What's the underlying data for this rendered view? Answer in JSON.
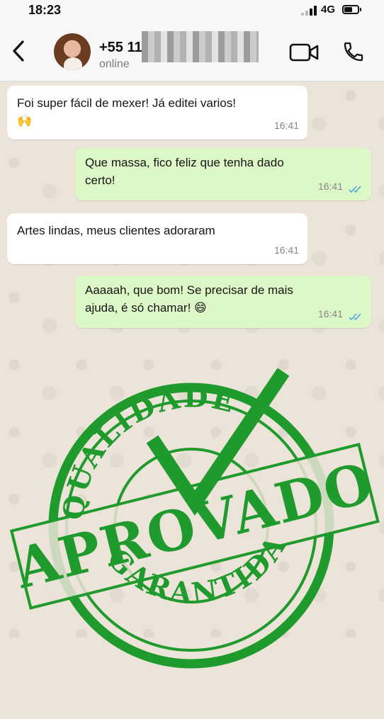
{
  "status_bar": {
    "time": "18:23",
    "network": "4G"
  },
  "header": {
    "contact_name": "+55 11",
    "contact_status": "online",
    "icons": [
      "back-arrow-icon",
      "video-call-icon",
      "phone-icon"
    ]
  },
  "messages": [
    {
      "direction": "in",
      "text": "Foi super fácil de mexer! Já editei varios!",
      "emoji": "🙌",
      "time": "16:41"
    },
    {
      "direction": "out",
      "text": "Que massa, fico feliz que tenha dado\ncerto!",
      "time": "16:41",
      "status": "read"
    },
    {
      "direction": "in",
      "text": "Artes lindas, meus clientes adoraram",
      "time": "16:41"
    },
    {
      "direction": "out",
      "text": "Aaaaah, que bom! Se precisar de mais\najuda, é só chamar!",
      "emoji": "😄",
      "time": "16:41",
      "status": "read"
    }
  ],
  "stamp": {
    "top_text": "QUALIDADE",
    "main_text": "APROVADO",
    "bottom_text": "GARANTIDA",
    "color": "#1f9a2c"
  },
  "colors": {
    "outgoing_bubble": "#dcf8c6",
    "incoming_bubble": "#ffffff",
    "read_ticks": "#4fa8e0",
    "chat_background": "#ece4d8"
  }
}
